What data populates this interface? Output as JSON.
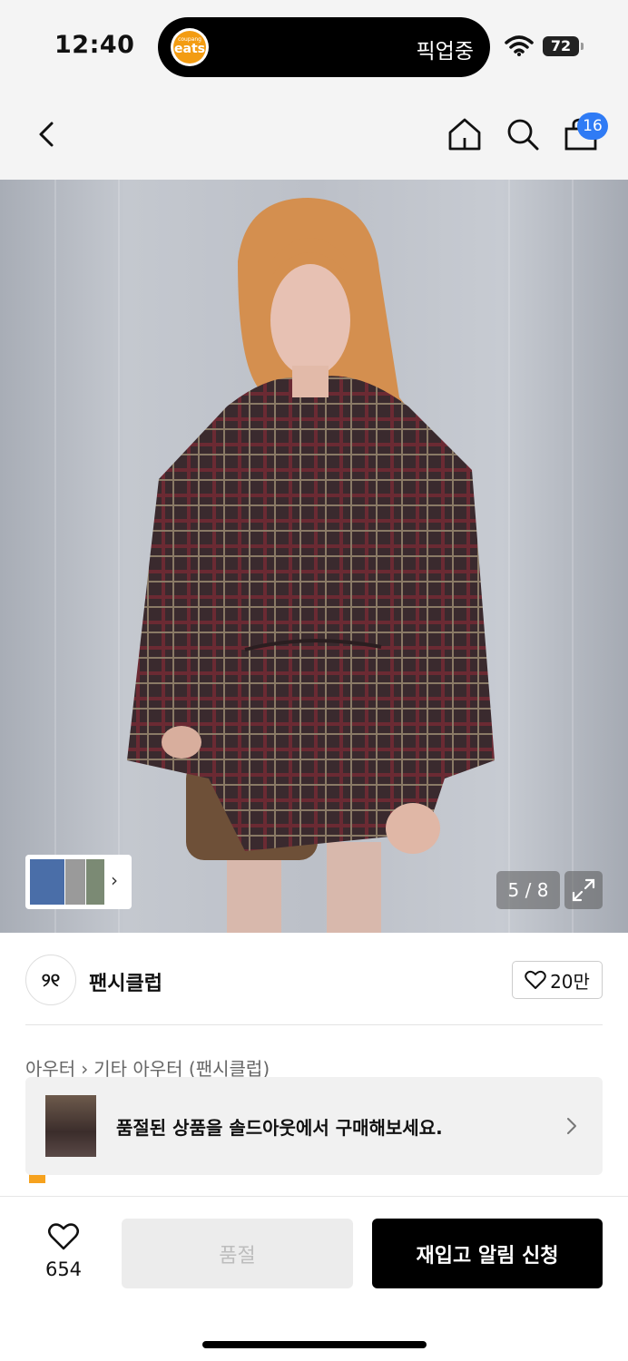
{
  "status_bar": {
    "time": "12:40",
    "island_app_small": "coupang",
    "island_app_big": "eats",
    "island_status": "픽업중",
    "battery": "72"
  },
  "nav": {
    "cart_count": "16"
  },
  "gallery": {
    "page_indicator": "5 / 8",
    "thumb_arrow": "›"
  },
  "brand": {
    "logo_text": "୨୧",
    "name": "팬시클럽",
    "likes": "20만"
  },
  "breadcrumb": {
    "category": "아우터",
    "separator": "›",
    "subcategory": "기타 아우터 (팬시클럽)"
  },
  "soldout_banner": {
    "text": "품절된 상품을 솔드아웃에서 구매해보세요."
  },
  "bottom_bar": {
    "wish_count": "654",
    "soldout_label": "품절",
    "restock_label": "재입고 알림 신청"
  },
  "colors": {
    "accent_badge": "#2f7bf5",
    "primary_button": "#000000",
    "disabled_button": "#ececec"
  }
}
